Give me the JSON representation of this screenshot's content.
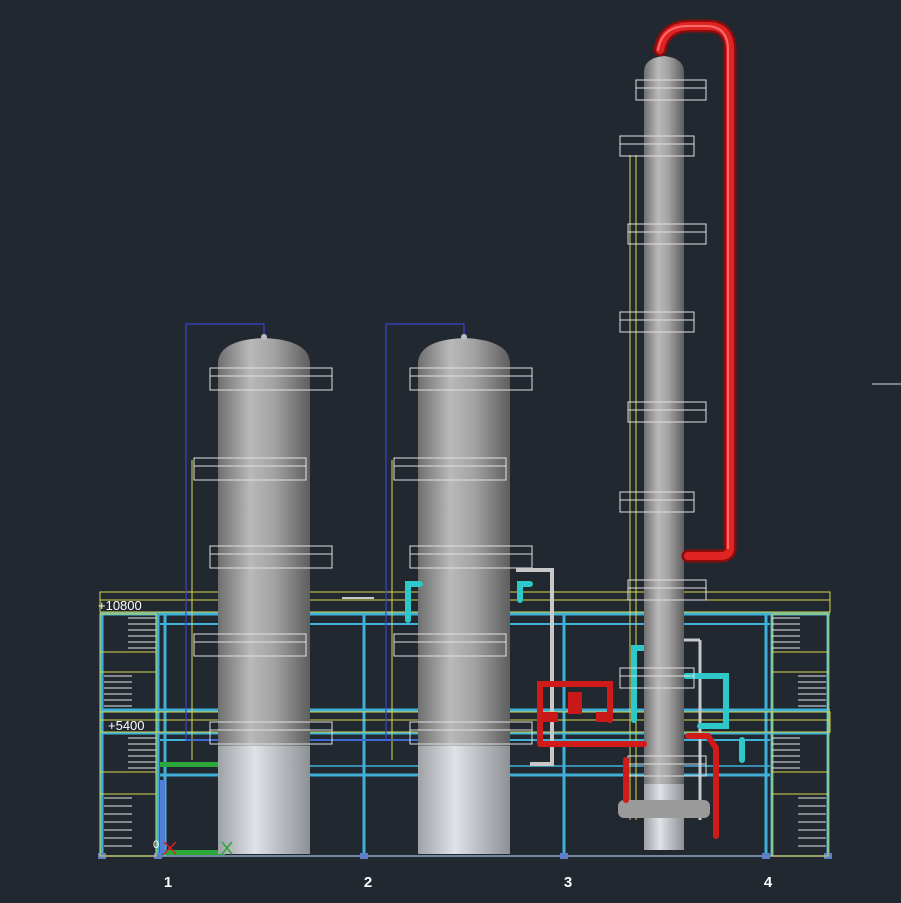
{
  "drawing": {
    "background_color": "#212830",
    "elevation_labels": [
      "+10800",
      "+5400"
    ],
    "grid_labels": [
      "1",
      "2",
      "3",
      "4"
    ],
    "ucs_origin_label": "0"
  },
  "legend_colors": {
    "vessel_shell": "#a9a9a9",
    "vessel_base": "#c9ccd0",
    "steel_structure": "#3fb0d8",
    "platforms_stairs": "#d8d84a",
    "hot_piping": "#d11a1a",
    "cooling_piping": "#2fc8c8",
    "process_piping": "#c8c8c8",
    "instrument_lines": "#2d36b8"
  }
}
